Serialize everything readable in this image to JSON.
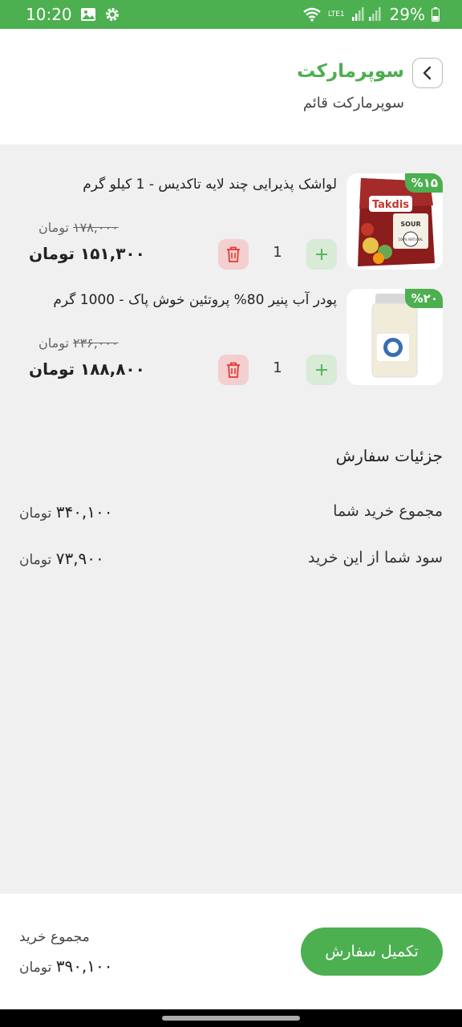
{
  "status_bar": {
    "time": "10:20",
    "network": "LTE1",
    "battery": "29%",
    "left_icons": [
      "image-icon",
      "gear-icon"
    ],
    "right_icons": [
      "wifi-icon",
      "signal-icon",
      "battery-icon"
    ]
  },
  "header": {
    "title": "سوپرمارکت",
    "subtitle": "سوپرمارکت قائم",
    "back_icon": "chevron-left-icon"
  },
  "cart": {
    "items": [
      {
        "name": "لواشک پذیرایی چند لایه تاکدیس - 1 کیلو گرم",
        "discount": "%۱۵",
        "old_price": "۱۷۸,۰۰۰",
        "old_currency": "تومان",
        "price": "۱۵۱,۳۰۰",
        "currency": "تومان",
        "quantity": "1",
        "image": {
          "brand_text": "Takdis",
          "label_line1": "SOUR",
          "label_line2": "100% NATURAL"
        }
      },
      {
        "name": "پودر آب پنیر 80% پروتئین خوش پاک - 1000 گرم",
        "discount": "%۲۰",
        "old_price": "۲۳۶,۰۰۰",
        "old_currency": "تومان",
        "price": "۱۸۸,۸۰۰",
        "currency": "تومان",
        "quantity": "1"
      }
    ]
  },
  "order_details": {
    "title": "جزئیات سفارش",
    "rows": [
      {
        "label": "مجموع خرید شما",
        "value": "۳۴۰,۱۰۰",
        "currency": "تومان"
      },
      {
        "label": "سود شما از این خرید",
        "value": "۷۳,۹۰۰",
        "currency": "تومان"
      }
    ]
  },
  "footer": {
    "total_label": "مجموع خرید",
    "total_value": "۳۹۰,۱۰۰",
    "total_currency": "تومان",
    "checkout_label": "تکمیل سفارش"
  },
  "colors": {
    "accent": "#4caf50",
    "plus_bg": "#d7ebd7",
    "delete_bg": "#f3cfcf",
    "delete_icon": "#e53935",
    "background": "#f0f0f0"
  }
}
